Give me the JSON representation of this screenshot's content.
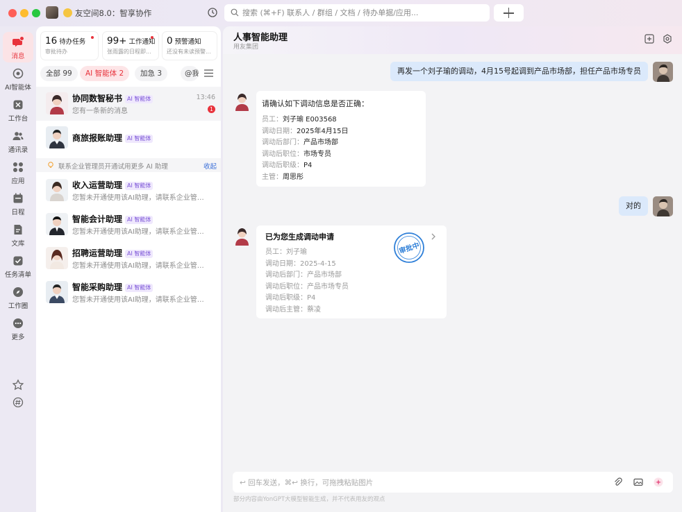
{
  "app": {
    "title": "友空间8.0：智享协作",
    "search_placeholder": "搜索 (⌘+F) 联系人 / 群组 / 文档 / 待办单据/应用..."
  },
  "nav": [
    {
      "label": "消息",
      "icon": "chat-icon",
      "active": true
    },
    {
      "label": "AI智能体",
      "icon": "ai-agent-icon"
    },
    {
      "label": "工作台",
      "icon": "workbench-icon"
    },
    {
      "label": "通讯录",
      "icon": "contacts-icon"
    },
    {
      "label": "应用",
      "icon": "apps-icon"
    },
    {
      "label": "日程",
      "icon": "calendar-icon"
    },
    {
      "label": "文库",
      "icon": "library-icon"
    },
    {
      "label": "任务清单",
      "icon": "task-list-icon"
    },
    {
      "label": "工作圈",
      "icon": "work-circle-icon"
    },
    {
      "label": "更多",
      "icon": "more-icon"
    }
  ],
  "cards": [
    {
      "num": "16",
      "label": "待办任务",
      "sub": "审批待办"
    },
    {
      "num": "99+",
      "label": "工作通知",
      "sub": "张雨露的日程即..."
    },
    {
      "num": "0",
      "label": "预警通知",
      "sub": "还没有未读预警..."
    }
  ],
  "filters": [
    "全部 99",
    "AI 智能体 2",
    "加急 3",
    "@我"
  ],
  "ai_tag": "AI 智能体",
  "pinned": [
    {
      "name": "协同数智秘书",
      "preview": "您有一条新的消息",
      "time": "13:46",
      "badge": "1"
    },
    {
      "name": "商旅报账助理",
      "preview": ""
    }
  ],
  "tip": {
    "text": "联系企业管理员开通试用更多 AI 助理",
    "collapse": "收起"
  },
  "assistants": [
    {
      "name": "收入运营助理",
      "preview": "您暂未开通使用该AI助理，请联系企业管理员开通"
    },
    {
      "name": "智能会计助理",
      "preview": "您暂未开通使用该AI助理，请联系企业管理员开通"
    },
    {
      "name": "招聘运营助理",
      "preview": "您暂未开通使用该AI助理，请联系企业管理员开通"
    },
    {
      "name": "智能采购助理",
      "preview": "您暂未开通使用该AI助理，请联系企业管理员开通"
    }
  ],
  "chat": {
    "title": "人事智能助理",
    "subtitle": "用友集团",
    "msg1": "再发一个刘子瑜的调动，4月15号起调到产品市场部，担任产品市场专员",
    "confirm": {
      "header": "请确认如下调动信息是否正确：",
      "rows": [
        {
          "k": "员工：",
          "v": "刘子瑜 E003568"
        },
        {
          "k": "调动日期：",
          "v": "2025年4月15日"
        },
        {
          "k": "调动后部门：",
          "v": "产品市场部"
        },
        {
          "k": "调动后职位：",
          "v": "市场专员"
        },
        {
          "k": "调动后职级：",
          "v": "P4"
        },
        {
          "k": "主管：",
          "v": "周思彤"
        }
      ]
    },
    "msg2": "对的",
    "result": {
      "header": "已为您生成调动申请",
      "stamp": "审批中",
      "rows": [
        "员工：刘子瑜",
        "调动日期：2025-4-15",
        "调动后部门：产品市场部",
        "调动后职位：产品市场专员",
        "调动后职级：P4",
        "调动后主管：蔡凌"
      ]
    },
    "composer_placeholder": "↩ 回车发送，⌘↩ 换行，可拖拽粘贴图片",
    "disclaimer": "部分内容由YonGPT大模型智能生成，并不代表用友的观点"
  },
  "colors": {
    "accent": "#e8333c",
    "out_bubble": "#dbe9fb",
    "ai_tag": "#7a52d6",
    "stamp": "#2e7fd8"
  }
}
